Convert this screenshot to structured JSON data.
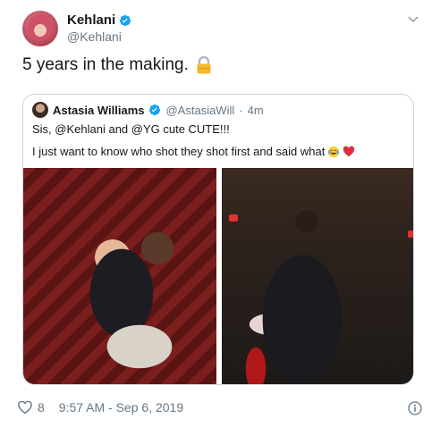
{
  "author": {
    "name": "Kehlani",
    "handle": "@Kehlani"
  },
  "tweet": {
    "text": "5 years in the making.",
    "emoji": "lock"
  },
  "quote": {
    "name": "Astasia Williams",
    "handle": "@AstasiaWill",
    "separator": "·",
    "time": "4m",
    "line1": "Sis, @Kehlani and @YG cute CUTE!!!",
    "line2": "I just want to know who shot they shot first and said what",
    "line2_emojis": [
      "tears-of-joy-emoji",
      "red-heart-emoji"
    ]
  },
  "footer": {
    "likes": "8",
    "timestamp": "9:57 AM - Sep 6, 2019"
  },
  "colors": {
    "verified": "#1da1f2",
    "muted": "#657786",
    "border": "#ccd6dd"
  }
}
